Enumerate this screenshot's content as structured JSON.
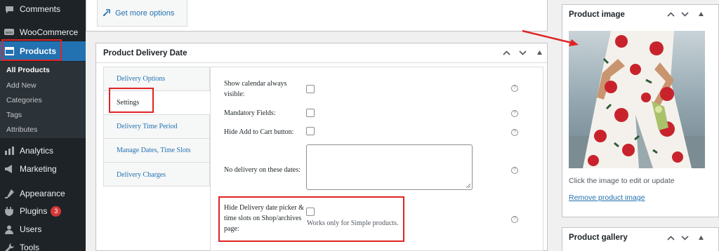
{
  "sidebar": {
    "items": [
      {
        "label": "Comments",
        "icon": "comments-icon"
      },
      {
        "label": "WooCommerce",
        "icon": "woocommerce-icon"
      },
      {
        "label": "Products",
        "icon": "products-icon"
      },
      {
        "label": "Analytics",
        "icon": "analytics-icon"
      },
      {
        "label": "Marketing",
        "icon": "marketing-icon"
      },
      {
        "label": "Appearance",
        "icon": "appearance-icon"
      },
      {
        "label": "Plugins",
        "icon": "plugins-icon",
        "badge": "3"
      },
      {
        "label": "Users",
        "icon": "users-icon"
      },
      {
        "label": "Tools",
        "icon": "tools-icon"
      }
    ],
    "submenu": [
      "All Products",
      "Add New",
      "Categories",
      "Tags",
      "Attributes"
    ]
  },
  "top_panel": {
    "link": "Get more options"
  },
  "delivery_panel": {
    "title": "Product Delivery Date",
    "tabs": [
      "Delivery Options",
      "Settings",
      "Delivery Time Period",
      "Manage Dates, Time Slots",
      "Delivery Charges"
    ],
    "fields": {
      "show_calendar": "Show calendar always visible:",
      "mandatory": "Mandatory Fields:",
      "hide_cart": "Hide Add to Cart button:",
      "no_delivery": "No delivery on these dates:",
      "hide_picker": "Hide Delivery date picker & time slots on Shop/archives page:",
      "hide_picker_note": "Works only for Simple products."
    },
    "help_glyph": "?"
  },
  "product_image": {
    "title": "Product image",
    "caption": "Click the image to edit or update",
    "remove": "Remove product image"
  },
  "product_gallery": {
    "title": "Product gallery"
  },
  "controls": {
    "up": "⌃",
    "down": "⌄",
    "toggle": "▲"
  },
  "colors": {
    "accent": "#2271b1",
    "highlight": "#e02424",
    "sidebar": "#1d2327"
  }
}
